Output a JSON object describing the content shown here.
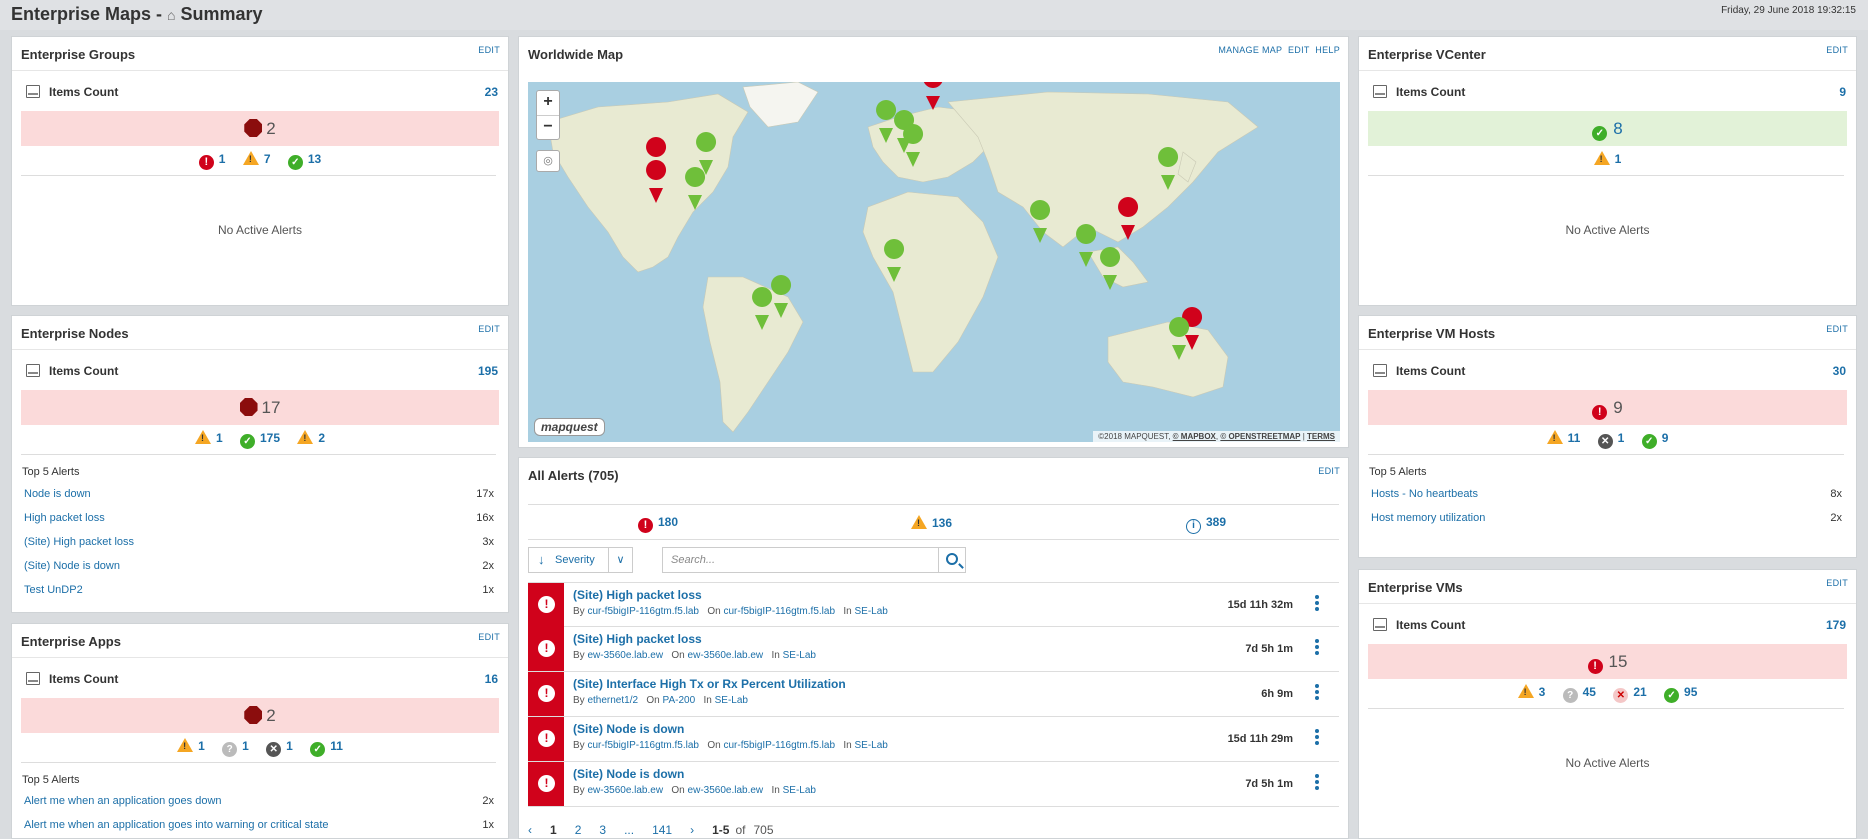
{
  "header": {
    "title": "Enterprise Maps - ",
    "home_glyph": "⌂",
    "subtitle": "Summary",
    "date": "Friday, 29 June 2018 19:32:15"
  },
  "groups": {
    "title": "Enterprise Groups",
    "edit": "EDIT",
    "items_label": "Items Count",
    "items_count": "23",
    "band_value": "2",
    "crit": "1",
    "warn": "7",
    "ok": "13",
    "no_alerts": "No Active Alerts"
  },
  "nodes": {
    "title": "Enterprise Nodes",
    "edit": "EDIT",
    "items_label": "Items Count",
    "items_count": "195",
    "band_value": "17",
    "warn": "1",
    "ok": "175",
    "warn2": "2",
    "top5_label": "Top 5 Alerts",
    "alerts": [
      {
        "name": "Node is down",
        "count": "17x"
      },
      {
        "name": "High packet loss",
        "count": "16x"
      },
      {
        "name": "(Site) High packet loss",
        "count": "3x"
      },
      {
        "name": "(Site) Node is down",
        "count": "2x"
      },
      {
        "name": "Test UnDP2",
        "count": "1x"
      }
    ]
  },
  "apps": {
    "title": "Enterprise Apps",
    "edit": "EDIT",
    "items_label": "Items Count",
    "items_count": "16",
    "band_value": "2",
    "warn": "1",
    "unknown": "1",
    "down": "1",
    "ok": "11",
    "top5_label": "Top 5 Alerts",
    "alerts": [
      {
        "name": "Alert me when an application goes down",
        "count": "2x"
      },
      {
        "name": "Alert me when an application goes into warning or critical state",
        "count": "1x"
      }
    ]
  },
  "worldmap": {
    "title": "Worldwide Map",
    "manage": "MANAGE MAP",
    "edit": "EDIT",
    "help": "HELP",
    "zoom_in": "+",
    "zoom_out": "−",
    "logo": "mapquest",
    "attr_prefix": "©2018 MAPQUEST, ",
    "attr_mapbox": "© MAPBOX",
    "attr_osm": "© OPENSTREETMAP",
    "attr_terms": "TERMS"
  },
  "alerts": {
    "title": "All Alerts (705)",
    "edit": "EDIT",
    "critical": "180",
    "warning": "136",
    "info": "389",
    "sort_label": "Severity",
    "search_placeholder": "Search...",
    "rows": [
      {
        "title": "(Site) High packet loss",
        "by_label": "By",
        "by": "cur-f5bigIP-116gtm.f5.lab",
        "on_label": "On",
        "on": "cur-f5bigIP-116gtm.f5.lab",
        "in_label": "In",
        "in": "SE-Lab",
        "duration": "15d 11h 32m"
      },
      {
        "title": "(Site) High packet loss",
        "by_label": "By",
        "by": "ew-3560e.lab.ew",
        "on_label": "On",
        "on": "ew-3560e.lab.ew",
        "in_label": "In",
        "in": "SE-Lab",
        "duration": "7d 5h 1m"
      },
      {
        "title": "(Site) Interface High Tx or Rx Percent Utilization",
        "by_label": "By",
        "by": "ethernet1/2",
        "on_label": "On",
        "on": "PA-200",
        "in_label": "In",
        "in": "SE-Lab",
        "duration": "6h 9m"
      },
      {
        "title": "(Site) Node is down",
        "by_label": "By",
        "by": "cur-f5bigIP-116gtm.f5.lab",
        "on_label": "On",
        "on": "cur-f5bigIP-116gtm.f5.lab",
        "in_label": "In",
        "in": "SE-Lab",
        "duration": "15d 11h 29m"
      },
      {
        "title": "(Site) Node is down",
        "by_label": "By",
        "by": "ew-3560e.lab.ew",
        "on_label": "On",
        "on": "ew-3560e.lab.ew",
        "in_label": "In",
        "in": "SE-Lab",
        "duration": "7d 5h 1m"
      }
    ],
    "pager": {
      "prev": "‹",
      "p1": "1",
      "p2": "2",
      "p3": "3",
      "ellipsis": "...",
      "last": "141",
      "next": "›",
      "range": "1-5",
      "of": "of",
      "total": "705"
    }
  },
  "vcenter": {
    "title": "Enterprise VCenter",
    "edit": "EDIT",
    "items_label": "Items Count",
    "items_count": "9",
    "band_value": "8",
    "warn": "1",
    "no_alerts": "No Active Alerts"
  },
  "vmhosts": {
    "title": "Enterprise VM Hosts",
    "edit": "EDIT",
    "items_label": "Items Count",
    "items_count": "30",
    "band_value": "9",
    "warn": "11",
    "down": "1",
    "ok": "9",
    "top5_label": "Top 5 Alerts",
    "alerts": [
      {
        "name": "Hosts - No heartbeats",
        "count": "8x"
      },
      {
        "name": "Host memory utilization",
        "count": "2x"
      }
    ]
  },
  "vms": {
    "title": "Enterprise VMs",
    "edit": "EDIT",
    "items_label": "Items Count",
    "items_count": "179",
    "band_value": "15",
    "warn": "3",
    "unknown": "45",
    "off": "21",
    "ok": "95",
    "no_alerts": "No Active Alerts"
  }
}
